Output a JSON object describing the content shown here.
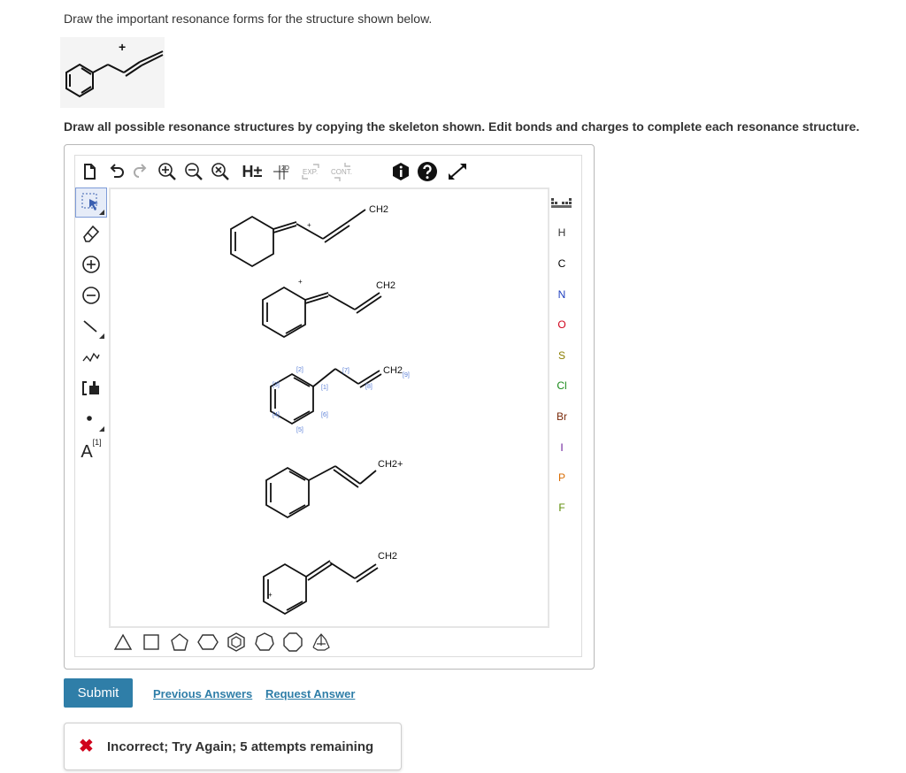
{
  "question": {
    "line1": "Draw the important resonance forms for the structure shown below.",
    "line2": "Draw all possible resonance structures by copying the skeleton shown. Edit bonds and charges to complete each resonance structure.",
    "charge_symbol": "+"
  },
  "editor": {
    "top_toolbar": {
      "hydrogen_label": "H±",
      "clean_2d_label": "2D",
      "expand_label": "EXP.",
      "contract_label": "CONT."
    },
    "left_toolbar": {
      "atom_map_label": "A",
      "atom_map_index": "[1]"
    },
    "elements": [
      "H",
      "C",
      "N",
      "O",
      "S",
      "Cl",
      "Br",
      "I",
      "P",
      "F"
    ],
    "element_colors": {
      "H": "#333333",
      "C": "#000000",
      "N": "#1f3fbf",
      "O": "#d0021b",
      "S": "#8b7d00",
      "Cl": "#1a8a1a",
      "Br": "#7a2a0a",
      "I": "#6a1b9a",
      "P": "#d96b00",
      "F": "#5a8a00"
    },
    "canvas": {
      "structures": [
        {
          "label": "CH2",
          "charge": "+"
        },
        {
          "label": "CH2",
          "charge": "+"
        },
        {
          "label": "CH2",
          "map_labels": [
            "[1]",
            "[2]",
            "[3]",
            "[4]",
            "[5]",
            "[6]",
            "[7]",
            "[8]",
            "[9]"
          ]
        },
        {
          "label": "CH2+"
        },
        {
          "label": "CH2",
          "charge": "+"
        }
      ]
    }
  },
  "actions": {
    "submit_label": "Submit",
    "previous_answers_label": "Previous Answers",
    "request_answer_label": "Request Answer"
  },
  "feedback": {
    "icon": "x-icon",
    "mark": "✖",
    "text": "Incorrect; Try Again; 5 attempts remaining"
  }
}
